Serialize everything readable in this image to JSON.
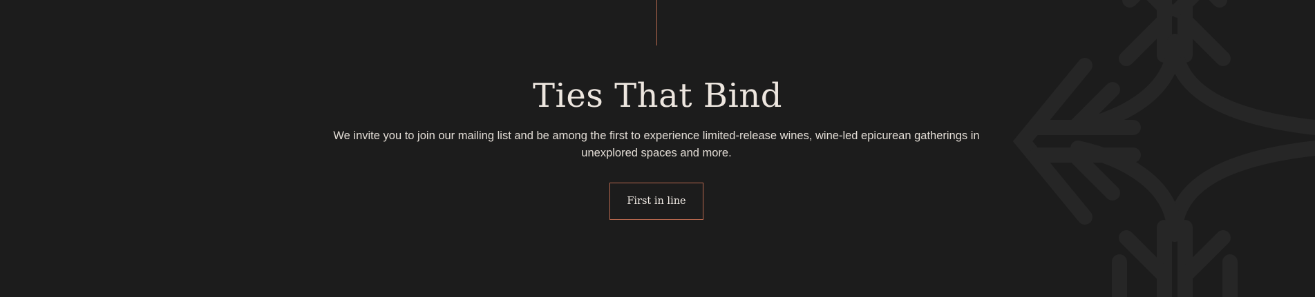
{
  "section": {
    "heading": "Ties That Bind",
    "description": "We invite you to join our mailing list and be among the first to experience limited-release wines, wine-led epicurean gatherings in unexplored spaces and more.",
    "cta_label": "First in line"
  },
  "colors": {
    "background": "#1c1c1c",
    "accent": "#b8694f",
    "text": "#ede6df",
    "ornament": "#262626"
  },
  "icons": {
    "ornament": "decorative-knot-ornament-icon"
  }
}
